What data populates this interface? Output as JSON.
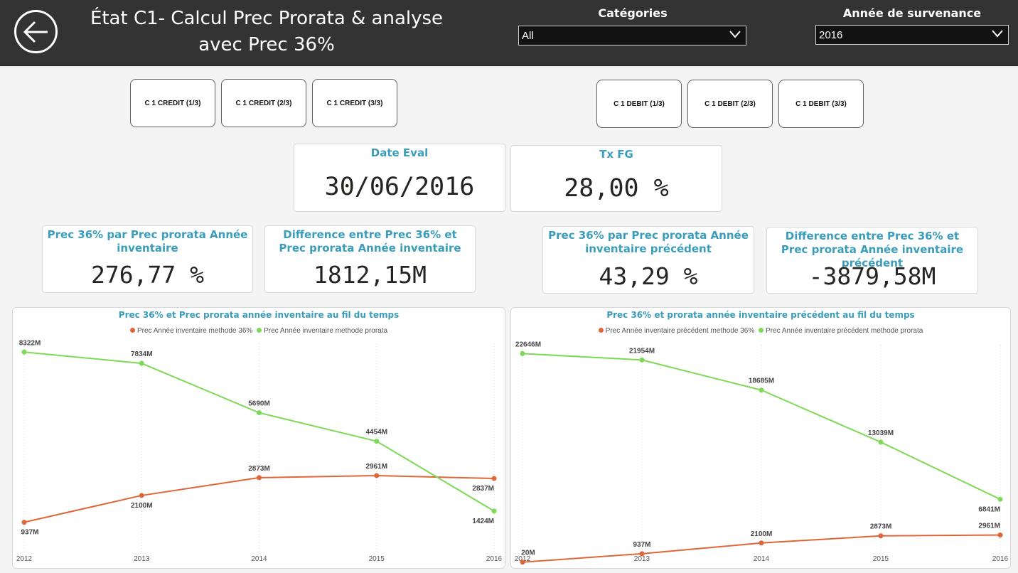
{
  "header": {
    "title_line1": "État C1- Calcul Prec Prorata & analyse",
    "title_line2": "avec Prec 36%",
    "slicers": [
      {
        "label": "Catégories",
        "value": "All"
      },
      {
        "label": "Année de survenance",
        "value": "2016"
      }
    ]
  },
  "nav_buttons": {
    "credit": [
      "C 1 CREDIT (1/3)",
      "C 1 CREDIT (2/3)",
      "C 1 CREDIT (3/3)"
    ],
    "debit": [
      "C 1 DEBIT (1/3)",
      "C 1 DEBIT (2/3)",
      "C 1 DEBIT (3/3)"
    ]
  },
  "kpi_top": [
    {
      "title": "Date Eval",
      "value": "30/06/2016"
    },
    {
      "title": "Tx FG",
      "value": "28,00 %"
    }
  ],
  "kpi_cards": [
    {
      "title": "Prec 36% par Prec prorata Année inventaire",
      "value": "276,77 %"
    },
    {
      "title": "Difference entre Prec 36% et Prec prorata Année inventaire",
      "value": "1812,15M"
    },
    {
      "title": "Prec 36% par Prec prorata Année inventaire précédent",
      "value": "43,29 %"
    },
    {
      "title": "Difference entre Prec 36% et Prec prorata Année inventaire précédent",
      "value": "-3879,58M"
    }
  ],
  "colors": {
    "orange": "#e0663a",
    "green": "#7ed957",
    "accent": "#3a9dbb",
    "header_bg": "#333333"
  },
  "icons": {
    "back": "arrow-left-circle-icon",
    "dropdown": "chevron-down-icon"
  },
  "chart_data": [
    {
      "type": "line",
      "title": "Prec 36% et Prec prorata année inventaire au fil du temps",
      "x": [
        "2012",
        "2013",
        "2014",
        "2015",
        "2016"
      ],
      "series": [
        {
          "name": "Prec Année inventaire methode 36%",
          "color": "#e0663a",
          "values": [
            937,
            2100,
            2873,
            2961,
            2837
          ],
          "labels": [
            "937M",
            "2100M",
            "2873M",
            "2961M",
            "2837M"
          ]
        },
        {
          "name": "Prec Année inventaire methode prorata",
          "color": "#7ed957",
          "values": [
            8322,
            7834,
            5690,
            4454,
            1424
          ],
          "labels": [
            "8322M",
            "7834M",
            "5690M",
            "4454M",
            "1424M"
          ]
        }
      ],
      "ylim": [
        0,
        8700
      ]
    },
    {
      "type": "line",
      "title": "Prec 36% et prorata année inventaire précédent au fil du temps",
      "x": [
        "2012",
        "2013",
        "2014",
        "2015",
        "2016"
      ],
      "series": [
        {
          "name": "Prec Année inventaire précédent methode 36%",
          "color": "#e0663a",
          "values": [
            20,
            937,
            2100,
            2873,
            2961
          ],
          "labels": [
            "20M",
            "937M",
            "2100M",
            "2873M",
            "2961M"
          ]
        },
        {
          "name": "Prec Année inventaire précédent methode prorata",
          "color": "#7ed957",
          "values": [
            22646,
            21954,
            18685,
            13039,
            6841
          ],
          "labels": [
            "22646M",
            "21954M",
            "18685M",
            "13039M",
            "6841M"
          ]
        }
      ],
      "ylim": [
        0,
        23600
      ]
    }
  ]
}
